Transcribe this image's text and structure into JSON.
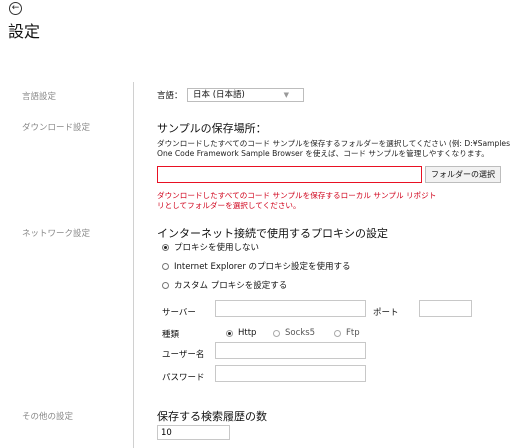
{
  "header": {
    "back_icon": "arrow-left-icon",
    "title": "設定"
  },
  "nav": {
    "language": "言語設定",
    "download": "ダウンロード設定",
    "network": "ネットワーク設定",
    "other": "その他の設定"
  },
  "language": {
    "label": "言語：",
    "value": "日本 (日本語)"
  },
  "download": {
    "heading": "サンプルの保存場所：",
    "desc1": "ダウンロードしたすべてのコード サンプルを保存するフォルダーを選択してください (例: D:¥Samples)",
    "desc2": "One Code Framework Sample Browser を使えば、コード サンプルを管理しやすくなります。",
    "path_value": "",
    "browse_label": "フォルダーの選択",
    "error1": "ダウンロードしたすべてのコード サンプルを保存するローカル サンプル リポジト",
    "error2": "リとしてフォルダーを選択してください。"
  },
  "network": {
    "heading": "インターネット接続で使用するプロキシの設定",
    "opt_none": "プロキシを使用しない",
    "opt_ie": "Internet Explorer のプロキシ設定を使用する",
    "opt_custom": "カスタム プロキシを設定する",
    "server_label": "サーバー",
    "server_value": "",
    "port_label": "ポート",
    "port_value": "",
    "type_label": "種類",
    "type_http": "Http",
    "type_socks": "Socks5",
    "type_ftp": "Ftp",
    "user_label": "ユーザー名",
    "user_value": "",
    "pass_label": "パスワード",
    "pass_value": ""
  },
  "other": {
    "heading": "保存する検索履歴の数",
    "history_value": "10"
  },
  "colors": {
    "error": "#d0021b",
    "error_border": "#e81123",
    "nav_text": "#888888"
  }
}
